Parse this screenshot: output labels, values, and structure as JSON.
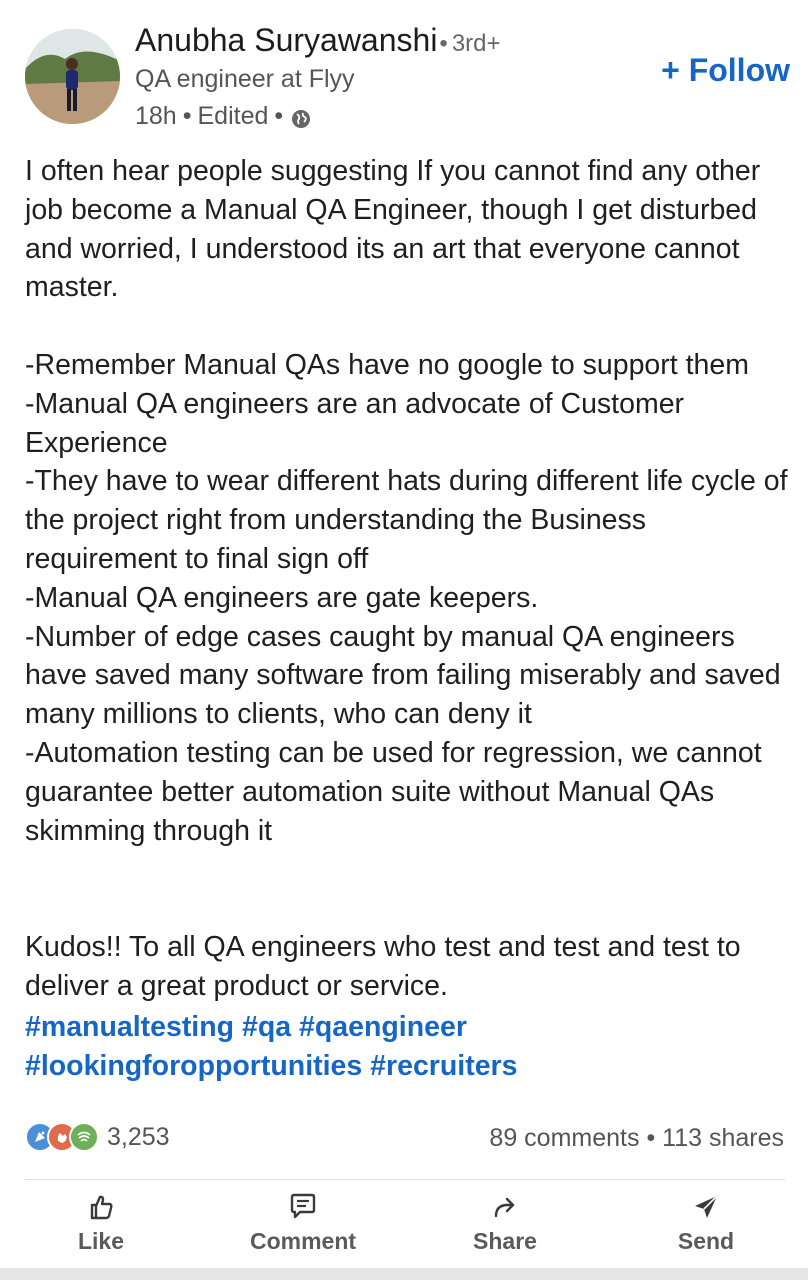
{
  "post": {
    "author": {
      "name": "Anubha Suryawanshi",
      "separator": "•",
      "degree": "3rd+",
      "headline": "QA engineer at Flyy",
      "time": "18h",
      "dot": "•",
      "edited": "Edited",
      "visibility_icon": "globe-icon"
    },
    "follow_label": "+ Follow",
    "body": {
      "intro": "I often hear people suggesting If you cannot find any other job become a Manual QA Engineer, though I get disturbed and worried,  I understood its an art that everyone cannot master.",
      "points": [
        "-Remember Manual QAs have no google to support them",
        "-Manual QA engineers are an advocate of Customer Experience",
        "-They have to wear different hats during different life cycle of the project right from understanding the Business requirement to final sign off",
        "-Manual QA engineers are gate keepers.",
        "-Number of edge cases caught by manual QA engineers have saved many software from failing miserably and saved many millions to clients, who can deny it",
        "-Automation testing can be used for regression, we cannot guarantee better automation suite without Manual QAs skimming through it"
      ],
      "closing": "Kudos!! To all QA engineers who test and test and test to deliver a great product or service."
    },
    "hashtags": [
      "#manualtesting",
      "#qa",
      "#qaengineer",
      "#lookingforopportunities",
      "#recruiters"
    ],
    "social": {
      "reaction_icons": [
        "celebrate-icon",
        "clap-icon",
        "insightful-icon"
      ],
      "reaction_count": "3,253",
      "comments": "89 comments",
      "dot": "•",
      "shares": "113 shares"
    },
    "actions": [
      {
        "label": "Like",
        "icon": "thumbs-up-icon"
      },
      {
        "label": "Comment",
        "icon": "comment-icon"
      },
      {
        "label": "Share",
        "icon": "share-arrow-icon"
      },
      {
        "label": "Send",
        "icon": "send-icon"
      }
    ],
    "colors": {
      "link_blue": "#1667c5",
      "text": "#1f1f1f",
      "muted": "#555555"
    }
  }
}
